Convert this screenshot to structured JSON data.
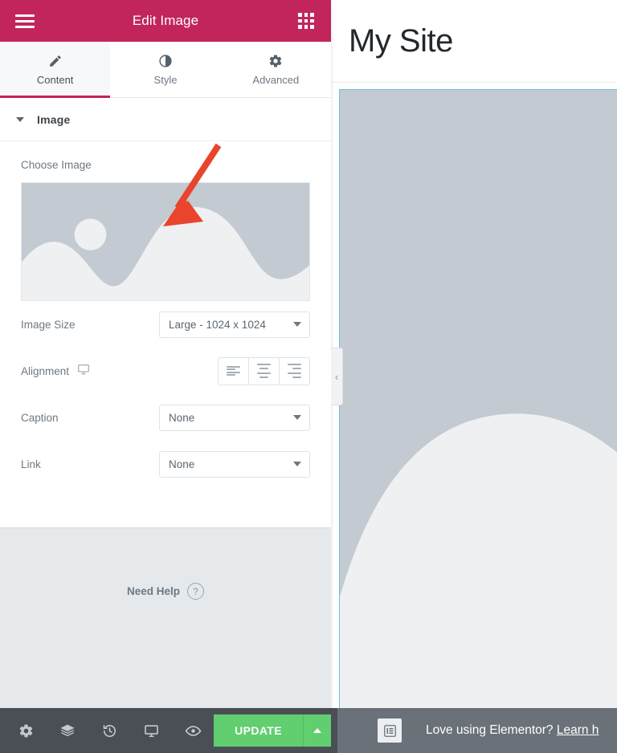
{
  "panel": {
    "header": {
      "title": "Edit Image",
      "menu_icon": "hamburger-icon",
      "widgets_icon": "grid-widgets-icon"
    },
    "tabs": [
      {
        "label": "Content",
        "icon": "pencil-icon",
        "active": true
      },
      {
        "label": "Style",
        "icon": "contrast-icon",
        "active": false
      },
      {
        "label": "Advanced",
        "icon": "gear-icon",
        "active": false
      }
    ],
    "section": {
      "title": "Image",
      "collapse_icon": "caret-down-icon"
    },
    "controls": {
      "choose_image_label": "Choose Image",
      "image_thumb_alt": "image-placeholder",
      "image_size": {
        "label": "Image Size",
        "value": "Large - 1024 x 1024"
      },
      "alignment": {
        "label": "Alignment",
        "device_icon": "desktop-icon",
        "options": [
          "align-left",
          "align-center",
          "align-right"
        ]
      },
      "caption": {
        "label": "Caption",
        "value": "None"
      },
      "link": {
        "label": "Link",
        "value": "None"
      }
    },
    "help": {
      "label": "Need Help",
      "icon": "question-mark-icon"
    },
    "footer": {
      "icons": [
        "settings-gear-icon",
        "navigator-layers-icon",
        "history-icon",
        "responsive-mode-icon",
        "preview-eye-icon"
      ],
      "update_label": "UPDATE",
      "update_caret_icon": "caret-up-icon"
    },
    "collapse_handle_icon": "chevron-left-icon"
  },
  "preview": {
    "site_title": "My Site",
    "selected_widget": "image-widget-placeholder"
  },
  "bottom_bar": {
    "wp_icon": "elementor-logo-icon",
    "message_prefix": "Love using Elementor?",
    "message_link": "Learn h"
  },
  "annotation": {
    "arrow_color": "#e8452c",
    "points_at": "image-thumbnail"
  },
  "colors": {
    "brand_pink": "#c2255c",
    "update_green": "#61ce70",
    "selection_blue": "#6ec1e4",
    "dark_bar": "#4a4f56",
    "preview_bar": "#6a7178"
  }
}
